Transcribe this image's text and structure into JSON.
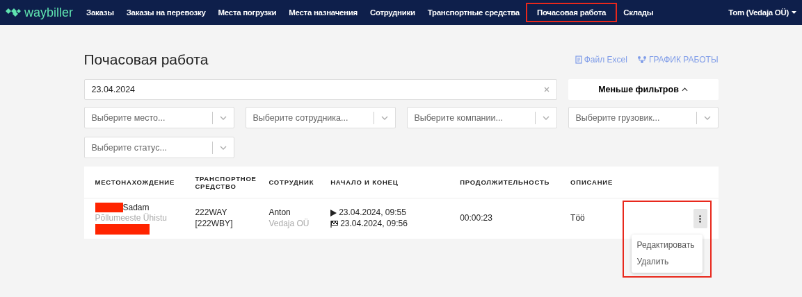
{
  "nav": {
    "logo": "waybiller",
    "items": [
      {
        "label": "Заказы",
        "highlighted": false
      },
      {
        "label": "Заказы на перевозку",
        "highlighted": false
      },
      {
        "label": "Места погрузки",
        "highlighted": false
      },
      {
        "label": "Места назначения",
        "highlighted": false
      },
      {
        "label": "Сотрудники",
        "highlighted": false
      },
      {
        "label": "Транспортные средства",
        "highlighted": false
      },
      {
        "label": "Почасовая работа",
        "highlighted": true
      },
      {
        "label": "Склады",
        "highlighted": false
      }
    ],
    "user": "Tom (Vedaja OÜ)"
  },
  "page": {
    "title": "Почасовая работа",
    "actions": [
      {
        "kind": "file",
        "label": "Файл Excel"
      },
      {
        "kind": "schedule",
        "label": "ГРАФИК РАБОТЫ"
      }
    ]
  },
  "date_field": {
    "value": "23.04.2024"
  },
  "filter_toggle": "Меньше фильтров",
  "filters": [
    {
      "placeholder": "Выберите место..."
    },
    {
      "placeholder": "Выберите сотрудника..."
    },
    {
      "placeholder": "Выберите компании..."
    },
    {
      "placeholder": "Выберите грузовик..."
    },
    {
      "placeholder": "Выберите статус..."
    }
  ],
  "table": {
    "columns": [
      "МЕСТОНАХОЖДЕНИЕ",
      "ТРАНСПОРТНОЕ СРЕДСТВО",
      "СОТРУДНИК",
      "НАЧАЛО И КОНЕЦ",
      "ПРОДОЛЖИТЕЛЬНОСТЬ",
      "ОПИСАНИЕ"
    ],
    "rows": [
      {
        "location": "Sadam",
        "location_sub": "Põllumeeste Ühistu",
        "vehicle": "222WAY [222WBY]",
        "employee": "Anton",
        "company": "Vedaja OÜ",
        "start": "23.04.2024, 09:55",
        "end": "23.04.2024, 09:56",
        "duration": "00:00:23",
        "description": "Töö",
        "menu_open": true
      }
    ]
  },
  "row_menu": [
    "Редактировать",
    "Удалить"
  ]
}
